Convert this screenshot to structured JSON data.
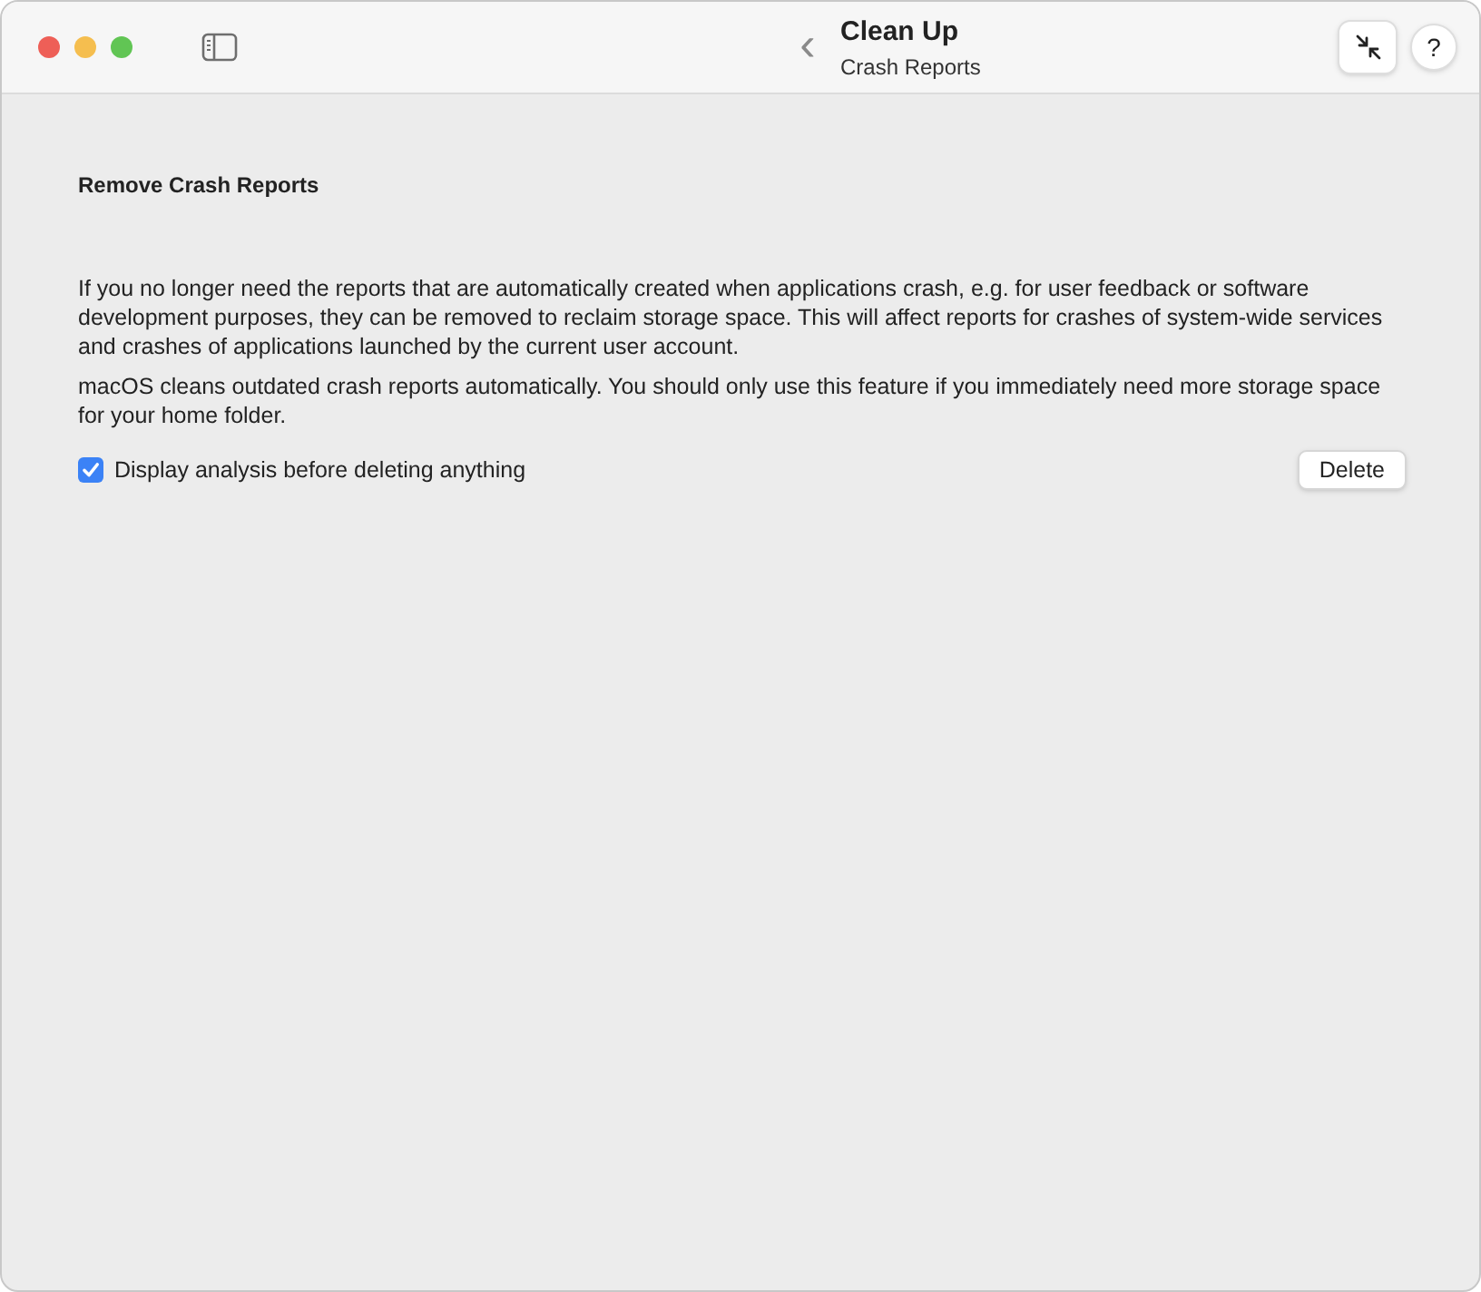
{
  "window": {
    "title": "Clean Up",
    "subtitle": "Crash Reports"
  },
  "toolbar": {
    "back": "‹",
    "help": "?"
  },
  "section": {
    "title": "Remove Crash Reports",
    "paragraphs": [
      "If you no longer need the reports that are automatically created when applications crash, e.g. for user feedback or software development purposes, they can be removed to reclaim storage space. This will affect reports for crashes of system-wide services and crashes of applications launched by the current user account.",
      "macOS cleans outdated crash reports automatically. You should only use this feature if you immediately need more storage space for your home folder."
    ],
    "checkbox": {
      "label": "Display analysis before deleting anything",
      "checked": true
    },
    "button": "Delete"
  }
}
